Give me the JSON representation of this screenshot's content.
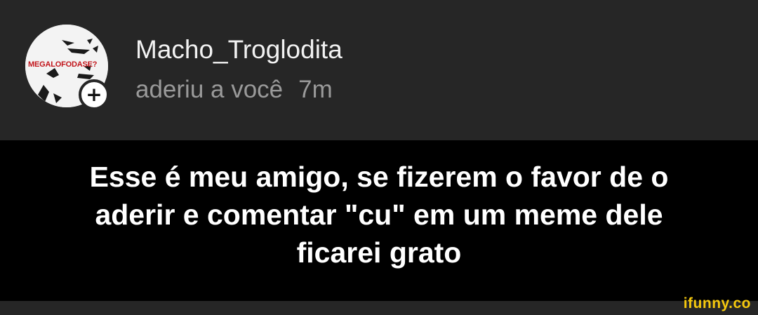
{
  "notification": {
    "username": "Macho_Troglodita",
    "action": "aderiu a você",
    "time": "7m",
    "avatar": {
      "overlay_text": "MEGALOFODASE?",
      "badge_icon": "plus-icon",
      "badge_symbol": "+"
    }
  },
  "caption": {
    "lines": [
      "Esse é meu amigo, se fizerem o favor de o",
      "aderir e comentar \"cu\" em um meme dele",
      "ficarei grato"
    ]
  },
  "watermark": "ifunny.co",
  "colors": {
    "background": "#262626",
    "caption_background": "#000000",
    "username": "#f2f2f2",
    "secondary_text": "#9a9a9a",
    "caption_text": "#ffffff",
    "watermark": "#f6c90e",
    "avatar_text": "#c2151b"
  }
}
